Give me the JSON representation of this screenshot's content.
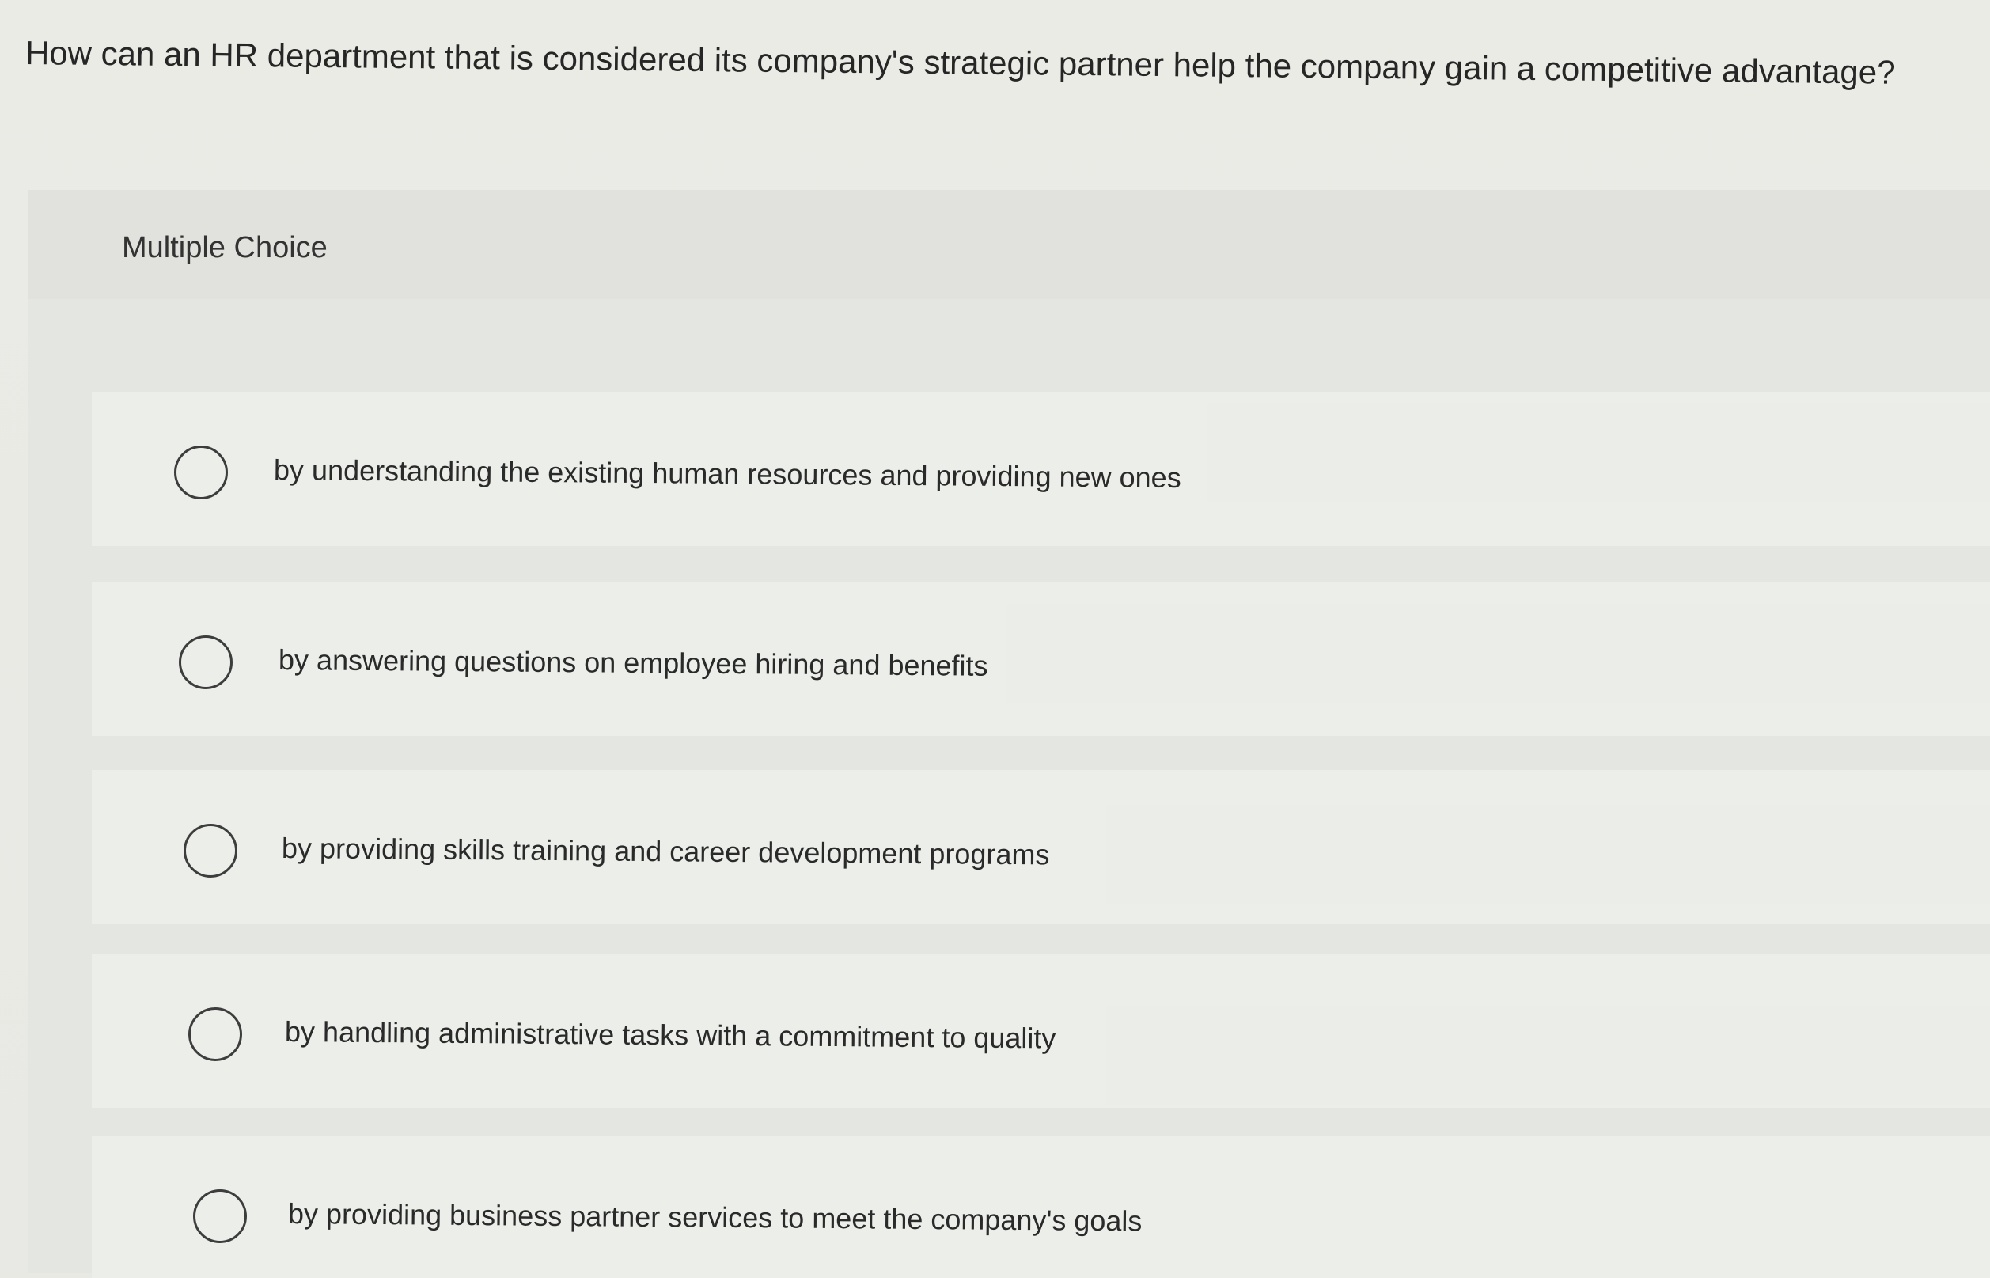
{
  "question": {
    "text": "How can an HR department that is considered its company's strategic partner help the company gain a competitive advantage?"
  },
  "card": {
    "header_label": "Multiple Choice"
  },
  "options": [
    {
      "label": "by understanding the existing human resources and providing new ones",
      "selected": false
    },
    {
      "label": "by answering questions on employee hiring and benefits",
      "selected": false
    },
    {
      "label": "by providing skills training and career development programs",
      "selected": false
    },
    {
      "label": "by handling administrative tasks with a commitment to quality",
      "selected": false
    },
    {
      "label": "by providing business partner services to meet the company's goals",
      "selected": false
    }
  ]
}
